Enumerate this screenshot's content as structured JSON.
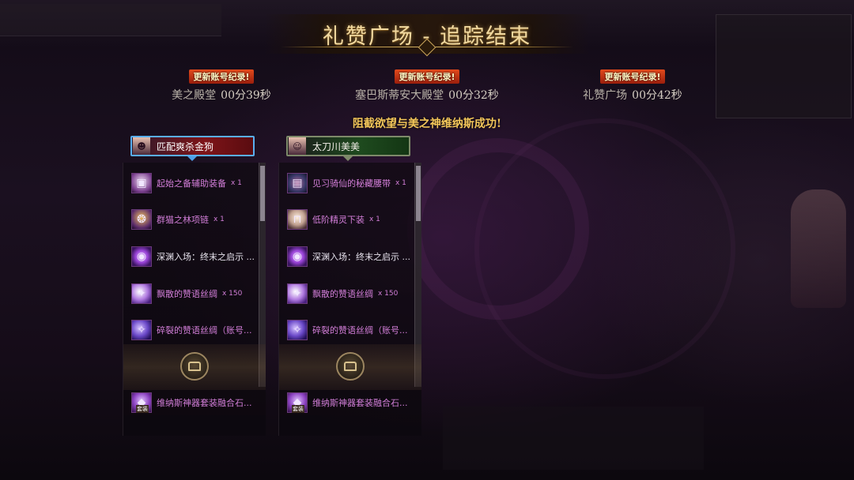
{
  "title": "礼赞广场 - 追踪结束",
  "records": [
    {
      "badge": "更新账号纪录!",
      "location": "美之殿堂",
      "time": "00分39秒"
    },
    {
      "badge": "更新账号纪录!",
      "location": "塞巴斯蒂安大殿堂",
      "time": "00分32秒"
    },
    {
      "badge": "更新账号纪录!",
      "location": "礼赞广场",
      "time": "00分42秒"
    }
  ],
  "success_message": "阻截欲望与美之神维纳斯成功!",
  "players": [
    {
      "name": "匹配爽杀金狗",
      "items": [
        {
          "name": "起始之备辅助装备",
          "qty": "x 1",
          "icon": "equipment-box-icon"
        },
        {
          "name": "群猫之林项链",
          "qty": "x 1",
          "icon": "necklace-icon"
        },
        {
          "name": "深渊入场：终末之启示 ...",
          "qty": "",
          "icon": "abyss-orb-icon"
        },
        {
          "name": "飘散的赞语丝绸",
          "qty": "x 150",
          "icon": "silk-icon"
        },
        {
          "name": "碎裂的赞语丝绸（账号...",
          "qty": "",
          "icon": "broken-silk-icon"
        }
      ],
      "set_item": {
        "name": "维纳斯神器套装融合石...",
        "tag": "套装",
        "icon": "fusion-stone-icon"
      }
    },
    {
      "name": "太刀川美美",
      "items": [
        {
          "name": "见习骑仙的秘藏腰带",
          "qty": "x 1",
          "icon": "belt-icon"
        },
        {
          "name": "低阶精灵下装",
          "qty": "x 1",
          "icon": "pants-icon"
        },
        {
          "name": "深渊入场：终末之启示 ...",
          "qty": "",
          "icon": "abyss-orb-icon"
        },
        {
          "name": "飘散的赞语丝绸",
          "qty": "x 150",
          "icon": "silk-icon"
        },
        {
          "name": "碎裂的赞语丝绸（账号...",
          "qty": "",
          "icon": "broken-silk-icon"
        }
      ],
      "set_item": {
        "name": "维纳斯神器套装融合石...",
        "tag": "套装",
        "icon": "fusion-stone-icon"
      }
    }
  ]
}
